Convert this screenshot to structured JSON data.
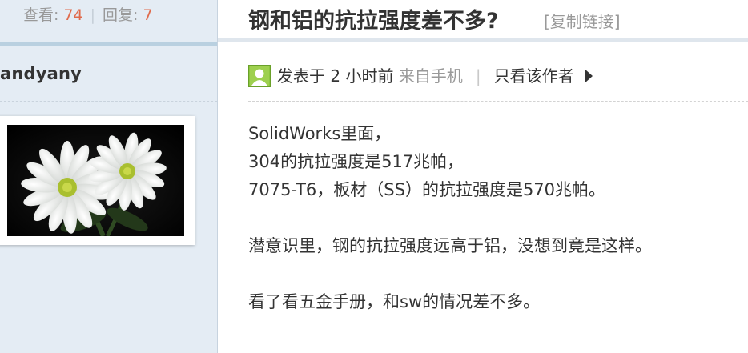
{
  "stats": {
    "views_label": "查看:",
    "views_count": "74",
    "separator": "|",
    "replies_label": "回复:",
    "replies_count": "7"
  },
  "author": {
    "username": "andyany"
  },
  "thread": {
    "title": "钢和铝的抗拉强度差不多?",
    "copy_link": "[复制链接]"
  },
  "post_meta": {
    "posted_prefix": "发表于",
    "posted_time": "2 小时前",
    "source": "来自手机",
    "separator": "|",
    "author_only": "只看该作者"
  },
  "post_body": {
    "line1": "SolidWorks里面，",
    "line2": "304的抗拉强度是517兆帕，",
    "line3": "7075-T6，板材（SS）的抗拉强度是570兆帕。",
    "line4": "潜意识里，钢的抗拉强度远高于铝，没想到竟是这样。",
    "line5": "看了看五金手册，和sw的情况差不多。"
  },
  "icons": {
    "avatar": "user-avatar-flowers",
    "meta_user": "user-icon",
    "expand": "triangle-right-icon"
  },
  "colors": {
    "stat_number": "#e06a4b",
    "sidebar_bg": "#e4ecf4",
    "user_icon_green": "#8cc63f"
  }
}
